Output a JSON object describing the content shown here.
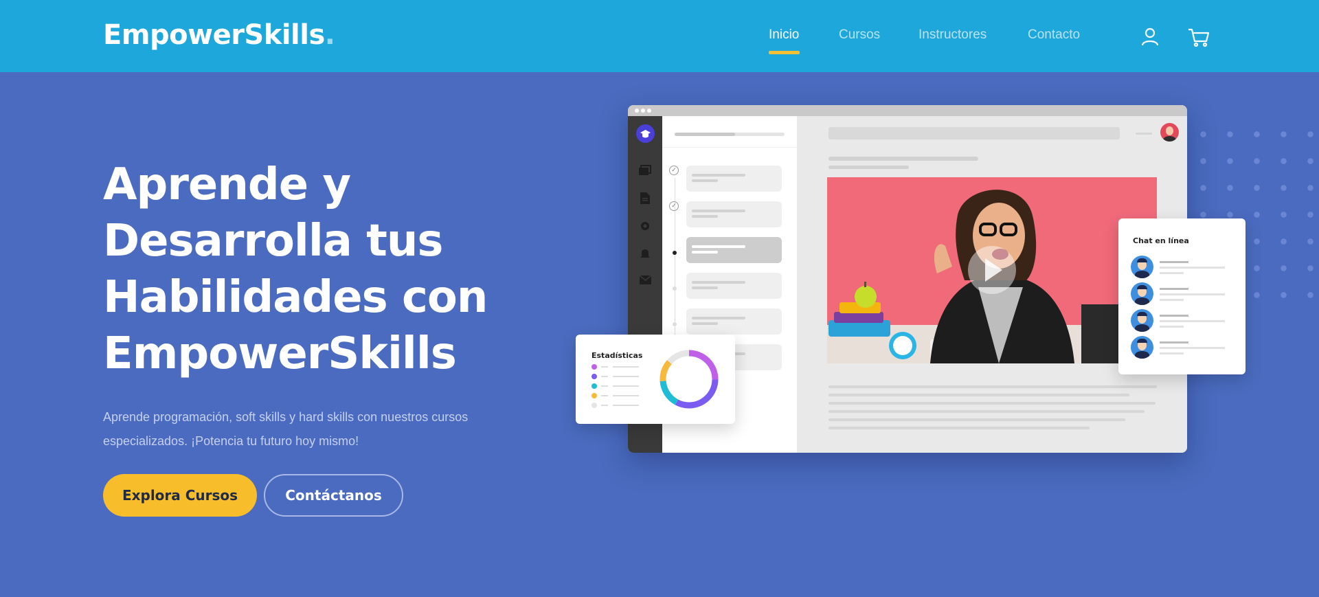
{
  "header": {
    "logo": "EmpowerSkills",
    "logo_dot": ".",
    "nav": [
      {
        "label": "Inicio",
        "active": true
      },
      {
        "label": "Cursos",
        "active": false
      },
      {
        "label": "Instructores",
        "active": false
      },
      {
        "label": "Contacto",
        "active": false
      }
    ],
    "icons": [
      "user-icon",
      "cart-icon"
    ]
  },
  "hero": {
    "title_lines": [
      "Aprende y",
      "Desarrolla tus",
      "Habilidades con",
      "EmpowerSkills"
    ],
    "subtitle": "Aprende programación, soft skills y hard skills con nuestros cursos especializados. ¡Potencia tu futuro hoy mismo!",
    "primary_button": "Explora Cursos",
    "secondary_button": "Contáctanos"
  },
  "mockup": {
    "stats_card_title": "Estadísticas",
    "chat_card_title": "Chat en línea",
    "donut_colors": [
      "#c060e8",
      "#7a5cf0",
      "#1fbcd6",
      "#f6b93b",
      "#e5e5e5"
    ],
    "sidebar_icons": [
      "graduation-cap-icon",
      "gallery-icon",
      "document-icon",
      "gear-icon",
      "bell-icon",
      "mail-icon"
    ]
  },
  "colors": {
    "header_bg": "#1ea7da",
    "hero_bg": "#4a6bbf",
    "accent": "#f7bd2b"
  }
}
